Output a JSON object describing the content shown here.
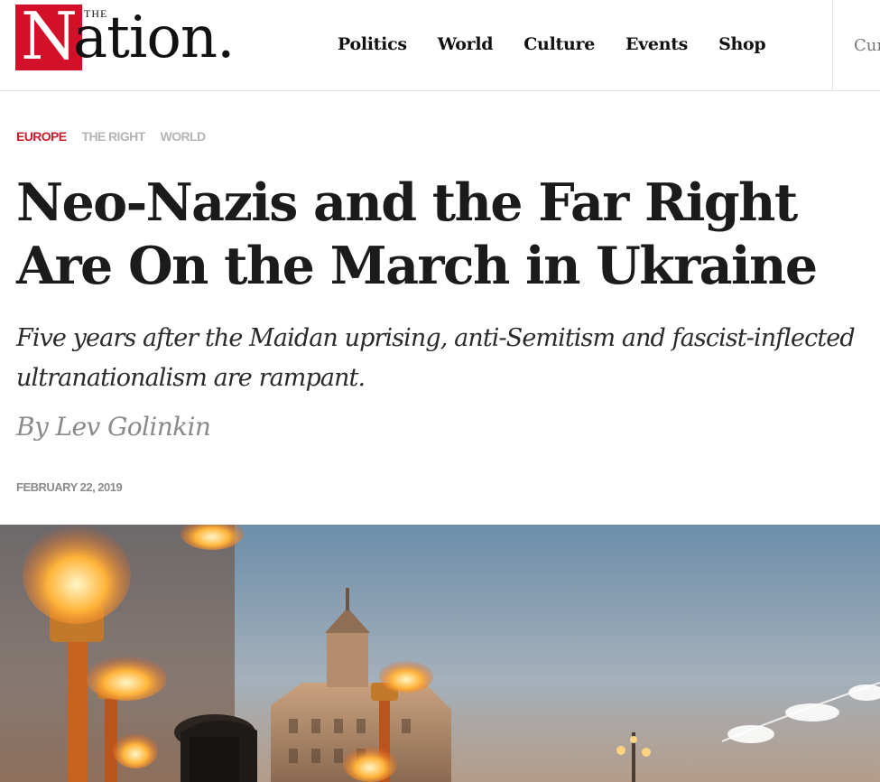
{
  "site": {
    "logo_the": "THE",
    "logo_n": "N",
    "logo_rest": "ation."
  },
  "nav": {
    "items": [
      {
        "label": "Politics"
      },
      {
        "label": "World"
      },
      {
        "label": "Culture"
      },
      {
        "label": "Events"
      },
      {
        "label": "Shop"
      }
    ],
    "cut_label": "Cur"
  },
  "article": {
    "tags": [
      {
        "label": "EUROPE"
      },
      {
        "label": "THE RIGHT"
      },
      {
        "label": "WORLD"
      }
    ],
    "headline": "Neo-Nazis and the Far Right Are On the March in Ukraine",
    "dek": "Five years after the Maidan uprising, anti-Semitism and fascist-inflected ultranationalism are rampant.",
    "byline": "By Lev Golinkin",
    "date": "FEBRUARY 22, 2019"
  },
  "colors": {
    "brand_red": "#d3102a",
    "tag_red": "#cf1a2b",
    "tag_gray": "#b5b5b5",
    "text_dark": "#1b1b1b"
  },
  "hero": {
    "icon": "torch-march-photo"
  }
}
